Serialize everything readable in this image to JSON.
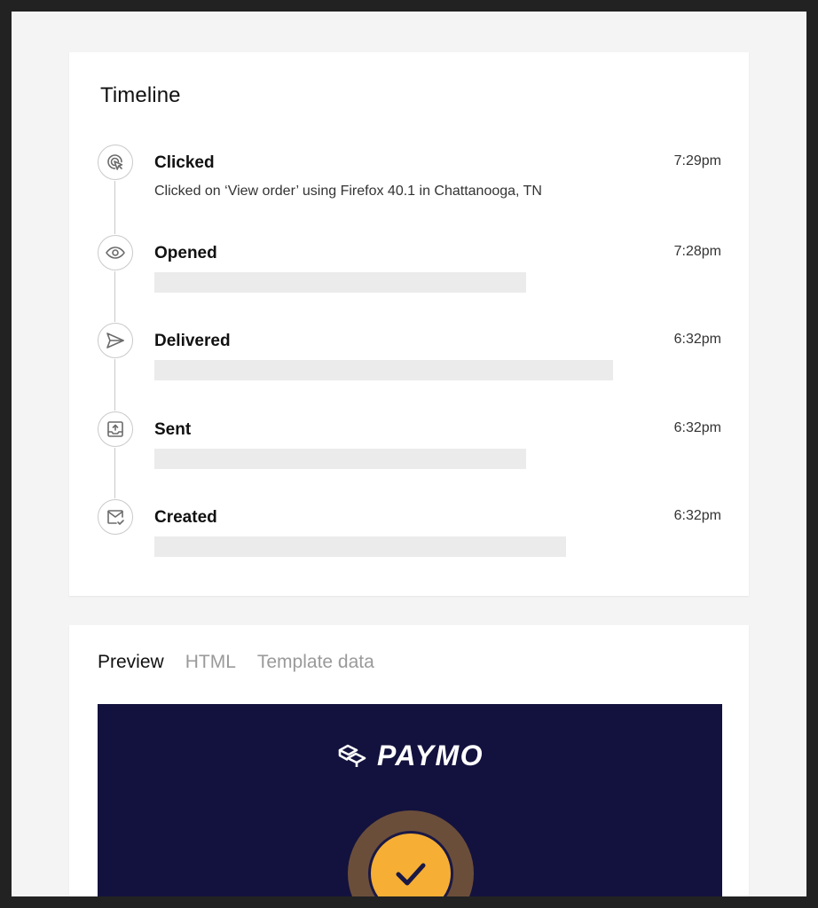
{
  "timeline": {
    "title": "Timeline",
    "events": [
      {
        "name": "Clicked",
        "time": "7:29pm",
        "description": "Clicked on ‘View order’ using Firefox 40.1 in Chattanooga, TN",
        "icon": "cursor-click-icon"
      },
      {
        "name": "Opened",
        "time": "7:28pm",
        "icon": "eye-icon"
      },
      {
        "name": "Delivered",
        "time": "6:32pm",
        "icon": "paper-plane-icon"
      },
      {
        "name": "Sent",
        "time": "6:32pm",
        "icon": "outbox-upload-icon"
      },
      {
        "name": "Created",
        "time": "6:32pm",
        "icon": "mail-check-icon"
      }
    ]
  },
  "preview": {
    "tabs": [
      {
        "label": "Preview",
        "active": true
      },
      {
        "label": "HTML",
        "active": false
      },
      {
        "label": "Template data",
        "active": false
      }
    ],
    "email": {
      "brand_name": "PAYMO",
      "brand_icon": "paymo-logo-icon",
      "status_icon": "checkmark-icon"
    }
  },
  "colors": {
    "background": "#f4f4f4",
    "card": "#ffffff",
    "email_background": "#13123e",
    "check_fill": "#f6af34",
    "check_ring": "#6b4e3a",
    "tab_active": "#111111",
    "tab_inactive": "#9a9a9a"
  }
}
